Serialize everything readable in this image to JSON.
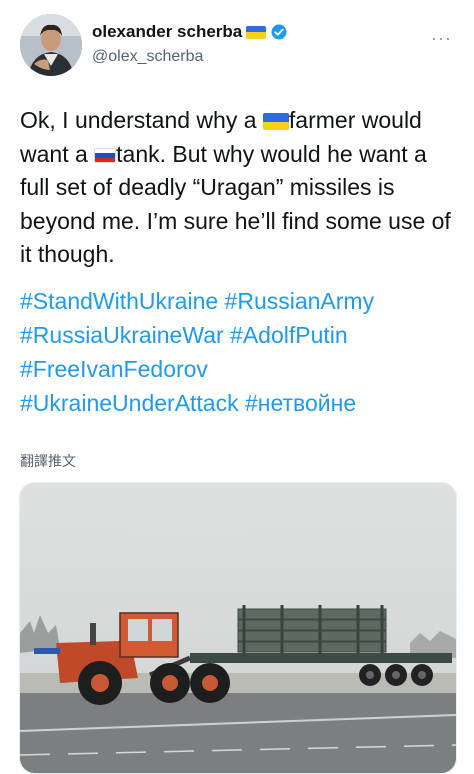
{
  "author": {
    "display_name": "olexander scherba",
    "handle": "@olex_scherba",
    "more_label": "···"
  },
  "tweet": {
    "text_part1": "Ok, I understand why a ",
    "text_part2": "farmer would want a ",
    "text_part3": "tank. But why would he want a full set of deadly “Uragan” missiles is beyond me. I’m sure he’ll find some use of it though.",
    "hashtags": [
      "#StandWithUkraine",
      "#RussianArmy",
      "#RussiaUkraineWar",
      "#AdolfPutin",
      "#FreeIvanFedorov",
      "#UkraineUnderAttack",
      "#нетвойне"
    ]
  },
  "translate_label": "翻譯推文",
  "icons": {
    "verified": "verified-badge-icon",
    "ukraine_flag": "ukraine-flag-icon",
    "russia_flag": "russia-flag-icon",
    "more": "more-options-icon"
  },
  "colors": {
    "link": "#1d9bf0",
    "secondary_text": "#536471",
    "verified": "#1d9bf0"
  }
}
